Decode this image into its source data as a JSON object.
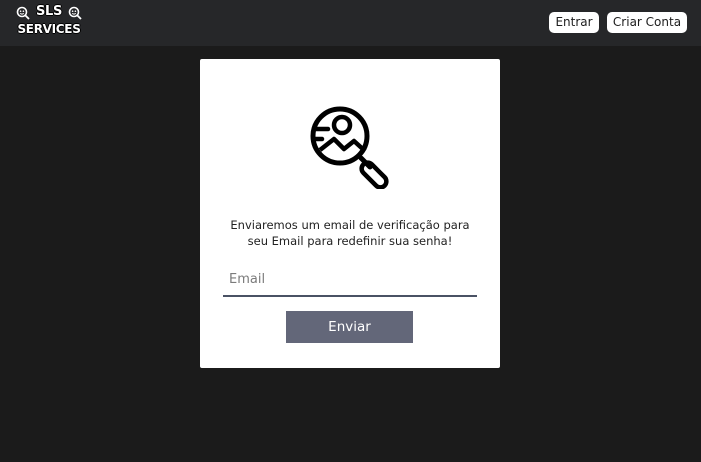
{
  "navbar": {
    "logo": {
      "line1": "SLS",
      "line2": "SERVICES"
    },
    "login_label": "Entrar",
    "signup_label": "Criar Conta"
  },
  "card": {
    "icon": "search-user-icon",
    "message_line1": "Enviaremos um email de verificação para",
    "message_line2": "seu Email para redefinir sua senha!",
    "email_placeholder": "Email",
    "email_value": "",
    "submit_label": "Enviar"
  },
  "colors": {
    "background": "#1b1b1b",
    "navbar": "#262729",
    "card": "#ffffff",
    "button": "#636779",
    "input_border": "#4a5264"
  }
}
